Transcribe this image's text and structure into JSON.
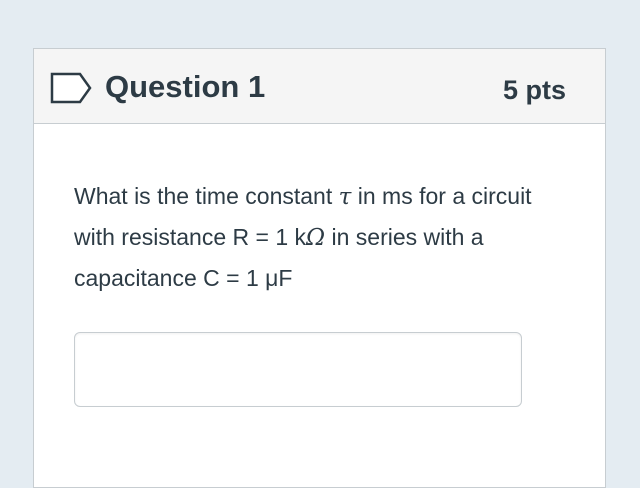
{
  "question": {
    "title": "Question 1",
    "points": "5 pts",
    "text_part1": "What is the time constant ",
    "tau_symbol": "τ",
    "text_part2": " in ms for a circuit with resistance R = 1 k",
    "omega_symbol": "Ω",
    "text_part3": " in series with a capacitance C = 1 μF"
  },
  "answer": {
    "value": "",
    "placeholder": ""
  },
  "icons": {
    "flag": "bookmark-flag-icon"
  },
  "colors": {
    "page_background": "#e4ecf2",
    "header_background": "#f5f5f5",
    "text": "#2d3b45",
    "border": "#c7cdd1",
    "flag_outline": "#2d3b45"
  }
}
